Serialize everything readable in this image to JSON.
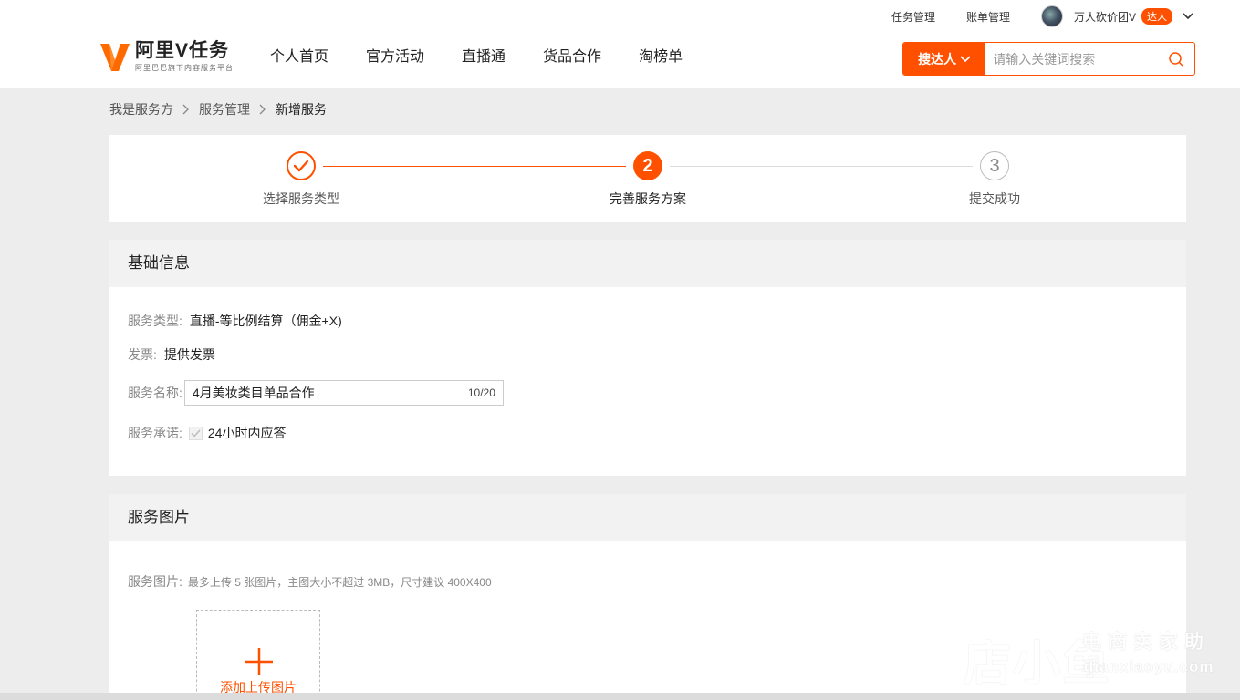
{
  "topbar": {
    "task_manage": "任务管理",
    "bill_manage": "账单管理",
    "username": "万人砍价团V",
    "user_badge": "达人"
  },
  "logo": {
    "title": "阿里V任务",
    "subtitle": "阿里巴巴旗下内容服务平台"
  },
  "nav": {
    "items": [
      {
        "label": "个人首页"
      },
      {
        "label": "官方活动"
      },
      {
        "label": "直播通"
      },
      {
        "label": "货品合作"
      },
      {
        "label": "淘榜单"
      }
    ]
  },
  "search": {
    "type_label": "搜达人",
    "placeholder": "请输入关键词搜索"
  },
  "breadcrumb": {
    "items": [
      "我是服务方",
      "服务管理",
      "新增服务"
    ]
  },
  "steps": {
    "items": [
      {
        "number": "1",
        "label": "选择服务类型",
        "status": "done"
      },
      {
        "number": "2",
        "label": "完善服务方案",
        "status": "active"
      },
      {
        "number": "3",
        "label": "提交成功",
        "status": "pending"
      }
    ]
  },
  "basic_info": {
    "title": "基础信息",
    "service_type_label": "服务类型:",
    "service_type_value": "直播-等比例结算（佣金+X)",
    "invoice_label": "发票:",
    "invoice_value": "提供发票",
    "service_name_label": "服务名称:",
    "service_name_value": "4月美妆类目单品合作",
    "service_name_count": "10/20",
    "promise_label": "服务承诺:",
    "promise_value": "24小时内应答"
  },
  "images": {
    "title": "服务图片",
    "label": "服务图片:",
    "hint": "最多上传 5 张图片，主图大小不超过 3MB，尺寸建议 400X400",
    "upload_label": "添加上传图片"
  },
  "watermark": {
    "text": "店小鱼",
    "sub1": "电商卖家助手",
    "sub2": "dianxiaoyu.com"
  },
  "colors": {
    "accent": "#ff5000",
    "background": "#ededed"
  }
}
